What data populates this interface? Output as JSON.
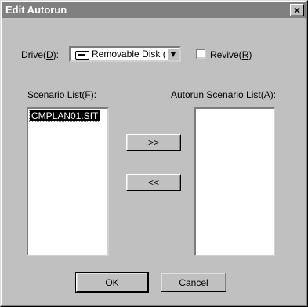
{
  "window": {
    "title": "Edit Autorun",
    "close_symbol": "×"
  },
  "drive": {
    "label_pre": "Drive(",
    "label_key": "D",
    "label_post": "):",
    "value": "Removable Disk (E:)",
    "icon": "removable-disk-icon"
  },
  "revive": {
    "label_pre": "Revive(",
    "label_key": "R",
    "label_post": ")",
    "checked": false
  },
  "scenario_list": {
    "label_pre": "Scenario List(",
    "label_key": "F",
    "label_post": "):",
    "items": [
      "CMPLAN01.SIT"
    ]
  },
  "autorun_list": {
    "label_pre": "Autorun Scenario List(",
    "label_key": "A",
    "label_post": "):",
    "items": []
  },
  "buttons": {
    "add": ">>",
    "remove": "<<",
    "ok": "OK",
    "cancel": "Cancel"
  }
}
